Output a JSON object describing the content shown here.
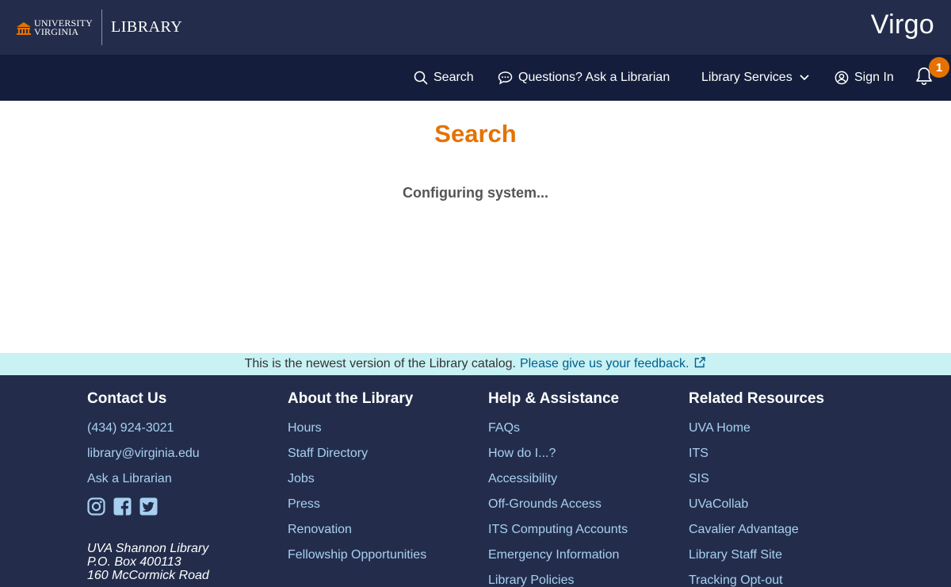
{
  "header": {
    "uva_line1": "UNIVERSITY",
    "uva_line2": "VIRGINIA",
    "library_label": "LIBRARY",
    "app_title": "Virgo"
  },
  "nav": {
    "search": "Search",
    "ask": "Questions? Ask a Librarian",
    "services": "Library Services",
    "sign_in": "Sign In",
    "notification_count": "1"
  },
  "main": {
    "title": "Search",
    "status": "Configuring system..."
  },
  "banner": {
    "text": "This is the newest version of the Library catalog.",
    "link": "Please give us your feedback."
  },
  "footer": {
    "contact": {
      "heading": "Contact Us",
      "items": [
        "(434) 924-3021",
        "library@virginia.edu",
        "Ask a Librarian"
      ],
      "address": [
        "UVA Shannon Library",
        "P.O. Box 400113",
        "160 McCormick Road"
      ]
    },
    "about": {
      "heading": "About the Library",
      "items": [
        "Hours",
        "Staff Directory",
        "Jobs",
        "Press",
        "Renovation",
        "Fellowship Opportunities"
      ]
    },
    "help": {
      "heading": "Help & Assistance",
      "items": [
        "FAQs",
        "How do I...?",
        "Accessibility",
        "Off-Grounds Access",
        "ITS Computing Accounts",
        "Emergency Information",
        "Library Policies"
      ]
    },
    "related": {
      "heading": "Related Resources",
      "items": [
        "UVA Home",
        "ITS",
        "SIS",
        "UVaCollab",
        "Cavalier Advantage",
        "Library Staff Site",
        "Tracking Opt-out"
      ]
    }
  },
  "colors": {
    "header_bg": "#232d4b",
    "nav_bg": "#141e3c",
    "accent_orange": "#e57200",
    "link_blue": "#a8d0f0",
    "banner_bg": "#c8f2f4"
  },
  "icons": [
    "rotunda-logo-icon",
    "search-icon",
    "chat-icon",
    "chevron-down-icon",
    "user-circle-icon",
    "bell-icon",
    "external-link-icon",
    "instagram-icon",
    "facebook-icon",
    "twitter-icon"
  ]
}
